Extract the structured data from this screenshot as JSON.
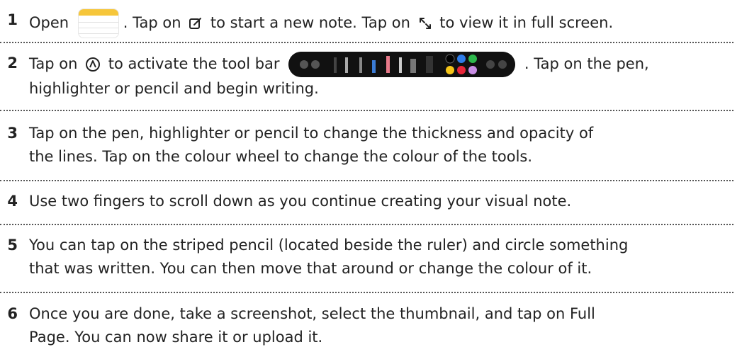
{
  "steps": [
    {
      "num": "1",
      "t1": "Open",
      "t2": ". Tap on",
      "t3": "to start a new note. Tap on",
      "t4": "to view it in full screen."
    },
    {
      "num": "2",
      "t1": "Tap on",
      "t2": "to activate the tool bar",
      "t3": ". Tap on the pen,",
      "l2": "highlighter or pencil and begin writing."
    },
    {
      "num": "3",
      "l1": "Tap on the pen, highlighter or pencil to change the thickness and opacity of",
      "l2": "the lines. Tap on the colour wheel to change the colour of the tools."
    },
    {
      "num": "4",
      "l1": "Use two fingers to scroll down as you continue creating your visual note."
    },
    {
      "num": "5",
      "l1": "You can tap on the striped pencil (located beside the ruler) and circle something",
      "l2": "that was written. You can then move that around or change the colour of it."
    },
    {
      "num": "6",
      "l1": "Once you are done, take a screenshot, select the thumbnail, and tap on Full",
      "l2": "Page. You can now share it or upload it."
    }
  ],
  "icons": {
    "notes_app": "notes-app-icon",
    "compose": "compose-icon",
    "fullscreen": "expand-arrows-icon",
    "markup": "markup-pen-icon",
    "toolbar": "markup-toolbar-image"
  },
  "colors": {
    "text": "#222222",
    "divider": "#555555",
    "notes_yellow": "#f6c63a",
    "toolbar_bg": "#111111"
  }
}
